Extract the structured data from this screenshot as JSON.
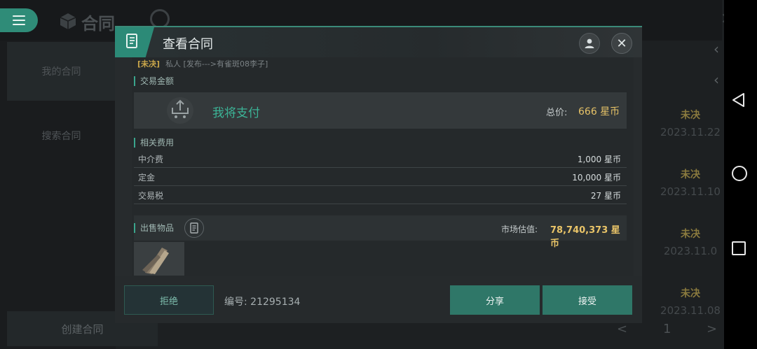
{
  "background": {
    "title": "合同",
    "sidebar": [
      "我的合同",
      "搜索合同"
    ],
    "create_button": "创建合同",
    "right_list": [
      {
        "status": "未决",
        "date": "2023.11.22"
      },
      {
        "status": "未决",
        "date": "2023.11.10"
      },
      {
        "status": "未决",
        "date": "2023.11.0"
      },
      {
        "status": "未决",
        "date": "2023.11.08"
      }
    ],
    "pager": {
      "prev": "<",
      "page": "1",
      "next": ">",
      "total": "1"
    }
  },
  "modal": {
    "title": "查看合同",
    "partial_line": {
      "status": "[未决]",
      "text": "私人 [发布--->有雀斑08李子]"
    },
    "trade_amount_label": "交易金额",
    "pay_text": "我将支付",
    "total_label": "总价:",
    "total_value": "666 星币",
    "fees_label": "相关费用",
    "fees": [
      {
        "name": "中介费",
        "value": "1,000 星币"
      },
      {
        "name": "定金",
        "value": "10,000 星币"
      },
      {
        "name": "交易税",
        "value": "27 星币"
      }
    ],
    "sale_items_label": "出售物品",
    "market_label": "市场估值:",
    "market_value": "78,740,373 星币",
    "reject": "拒绝",
    "serial": "编号: 21295134",
    "share": "分享",
    "accept": "接受"
  },
  "icons": [
    "menu-icon",
    "cube-icon",
    "contract-icon",
    "user-icon",
    "close-icon",
    "cart-upload-icon",
    "document-icon",
    "back-icon",
    "home-icon",
    "recents-icon"
  ],
  "colors": {
    "accent": "#2f8c78",
    "gold": "#e6c267",
    "green_text": "#3cb497"
  }
}
